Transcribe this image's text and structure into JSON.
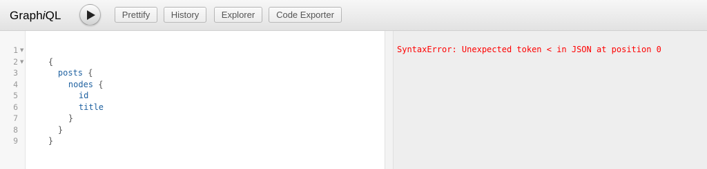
{
  "header": {
    "title_prefix": "Graph",
    "title_italic": "i",
    "title_suffix": "QL",
    "buttons": {
      "execute": "Execute Query",
      "prettify": "Prettify",
      "history": "History",
      "explorer": "Explorer",
      "code_exporter": "Code Exporter"
    }
  },
  "editor": {
    "line_numbers": [
      "1",
      "2",
      "3",
      "4",
      "5",
      "6",
      "7",
      "8",
      "9"
    ],
    "lines": {
      "l1": "{",
      "l2_field": "posts",
      "l2_brace": " {",
      "l3_field": "nodes",
      "l3_brace": " {",
      "l4_field": "id",
      "l5_field": "title",
      "l6": "}",
      "l7": "}",
      "l8": "}"
    }
  },
  "result": {
    "error_text": "SyntaxError: Unexpected token < in JSON at position 0",
    "error_color": "#ff0000"
  }
}
